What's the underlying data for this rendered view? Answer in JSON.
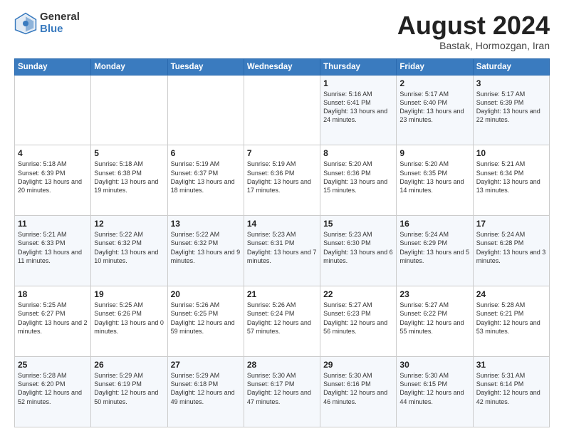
{
  "logo": {
    "general": "General",
    "blue": "Blue"
  },
  "title": "August 2024",
  "subtitle": "Bastak, Hormozgan, Iran",
  "days_of_week": [
    "Sunday",
    "Monday",
    "Tuesday",
    "Wednesday",
    "Thursday",
    "Friday",
    "Saturday"
  ],
  "weeks": [
    [
      {
        "day": "",
        "sunrise": "",
        "sunset": "",
        "daylight": ""
      },
      {
        "day": "",
        "sunrise": "",
        "sunset": "",
        "daylight": ""
      },
      {
        "day": "",
        "sunrise": "",
        "sunset": "",
        "daylight": ""
      },
      {
        "day": "",
        "sunrise": "",
        "sunset": "",
        "daylight": ""
      },
      {
        "day": "1",
        "sunrise": "5:16 AM",
        "sunset": "6:41 PM",
        "daylight": "13 hours and 24 minutes."
      },
      {
        "day": "2",
        "sunrise": "5:17 AM",
        "sunset": "6:40 PM",
        "daylight": "13 hours and 23 minutes."
      },
      {
        "day": "3",
        "sunrise": "5:17 AM",
        "sunset": "6:39 PM",
        "daylight": "13 hours and 22 minutes."
      }
    ],
    [
      {
        "day": "4",
        "sunrise": "5:18 AM",
        "sunset": "6:39 PM",
        "daylight": "13 hours and 20 minutes."
      },
      {
        "day": "5",
        "sunrise": "5:18 AM",
        "sunset": "6:38 PM",
        "daylight": "13 hours and 19 minutes."
      },
      {
        "day": "6",
        "sunrise": "5:19 AM",
        "sunset": "6:37 PM",
        "daylight": "13 hours and 18 minutes."
      },
      {
        "day": "7",
        "sunrise": "5:19 AM",
        "sunset": "6:36 PM",
        "daylight": "13 hours and 17 minutes."
      },
      {
        "day": "8",
        "sunrise": "5:20 AM",
        "sunset": "6:36 PM",
        "daylight": "13 hours and 15 minutes."
      },
      {
        "day": "9",
        "sunrise": "5:20 AM",
        "sunset": "6:35 PM",
        "daylight": "13 hours and 14 minutes."
      },
      {
        "day": "10",
        "sunrise": "5:21 AM",
        "sunset": "6:34 PM",
        "daylight": "13 hours and 13 minutes."
      }
    ],
    [
      {
        "day": "11",
        "sunrise": "5:21 AM",
        "sunset": "6:33 PM",
        "daylight": "13 hours and 11 minutes."
      },
      {
        "day": "12",
        "sunrise": "5:22 AM",
        "sunset": "6:32 PM",
        "daylight": "13 hours and 10 minutes."
      },
      {
        "day": "13",
        "sunrise": "5:22 AM",
        "sunset": "6:32 PM",
        "daylight": "13 hours and 9 minutes."
      },
      {
        "day": "14",
        "sunrise": "5:23 AM",
        "sunset": "6:31 PM",
        "daylight": "13 hours and 7 minutes."
      },
      {
        "day": "15",
        "sunrise": "5:23 AM",
        "sunset": "6:30 PM",
        "daylight": "13 hours and 6 minutes."
      },
      {
        "day": "16",
        "sunrise": "5:24 AM",
        "sunset": "6:29 PM",
        "daylight": "13 hours and 5 minutes."
      },
      {
        "day": "17",
        "sunrise": "5:24 AM",
        "sunset": "6:28 PM",
        "daylight": "13 hours and 3 minutes."
      }
    ],
    [
      {
        "day": "18",
        "sunrise": "5:25 AM",
        "sunset": "6:27 PM",
        "daylight": "13 hours and 2 minutes."
      },
      {
        "day": "19",
        "sunrise": "5:25 AM",
        "sunset": "6:26 PM",
        "daylight": "13 hours and 0 minutes."
      },
      {
        "day": "20",
        "sunrise": "5:26 AM",
        "sunset": "6:25 PM",
        "daylight": "12 hours and 59 minutes."
      },
      {
        "day": "21",
        "sunrise": "5:26 AM",
        "sunset": "6:24 PM",
        "daylight": "12 hours and 57 minutes."
      },
      {
        "day": "22",
        "sunrise": "5:27 AM",
        "sunset": "6:23 PM",
        "daylight": "12 hours and 56 minutes."
      },
      {
        "day": "23",
        "sunrise": "5:27 AM",
        "sunset": "6:22 PM",
        "daylight": "12 hours and 55 minutes."
      },
      {
        "day": "24",
        "sunrise": "5:28 AM",
        "sunset": "6:21 PM",
        "daylight": "12 hours and 53 minutes."
      }
    ],
    [
      {
        "day": "25",
        "sunrise": "5:28 AM",
        "sunset": "6:20 PM",
        "daylight": "12 hours and 52 minutes."
      },
      {
        "day": "26",
        "sunrise": "5:29 AM",
        "sunset": "6:19 PM",
        "daylight": "12 hours and 50 minutes."
      },
      {
        "day": "27",
        "sunrise": "5:29 AM",
        "sunset": "6:18 PM",
        "daylight": "12 hours and 49 minutes."
      },
      {
        "day": "28",
        "sunrise": "5:30 AM",
        "sunset": "6:17 PM",
        "daylight": "12 hours and 47 minutes."
      },
      {
        "day": "29",
        "sunrise": "5:30 AM",
        "sunset": "6:16 PM",
        "daylight": "12 hours and 46 minutes."
      },
      {
        "day": "30",
        "sunrise": "5:30 AM",
        "sunset": "6:15 PM",
        "daylight": "12 hours and 44 minutes."
      },
      {
        "day": "31",
        "sunrise": "5:31 AM",
        "sunset": "6:14 PM",
        "daylight": "12 hours and 42 minutes."
      }
    ]
  ]
}
